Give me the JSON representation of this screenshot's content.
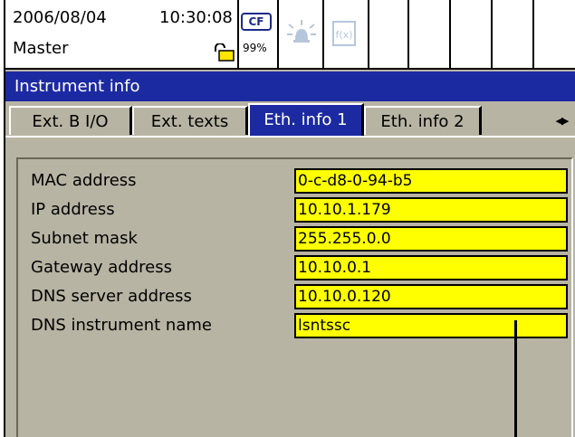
{
  "status": {
    "date": "2006/08/04",
    "time": "10:30:08",
    "mode": "Master",
    "cf_label": "CF",
    "cf_percent": "99%"
  },
  "title": "Instrument info",
  "tabs": [
    {
      "label": "Ext. B I/O",
      "active": false
    },
    {
      "label": "Ext. texts",
      "active": false
    },
    {
      "label": "Eth. info 1",
      "active": true
    },
    {
      "label": "Eth. info 2",
      "active": false
    }
  ],
  "rows": [
    {
      "label": "MAC address",
      "value": "0-c-d8-0-94-b5"
    },
    {
      "label": "IP address",
      "value": "10.10.1.179"
    },
    {
      "label": "Subnet mask",
      "value": "255.255.0.0"
    },
    {
      "label": "Gateway address",
      "value": "10.10.0.1"
    },
    {
      "label": "DNS server address",
      "value": "10.10.0.120"
    },
    {
      "label": "DNS instrument name",
      "value": "lsntssc"
    }
  ],
  "colors": {
    "title_bar": "#1c2aa2",
    "active_tab": "#1c2aa2",
    "panel_bg": "#b8b4a4",
    "value_field": "#ffff00"
  }
}
